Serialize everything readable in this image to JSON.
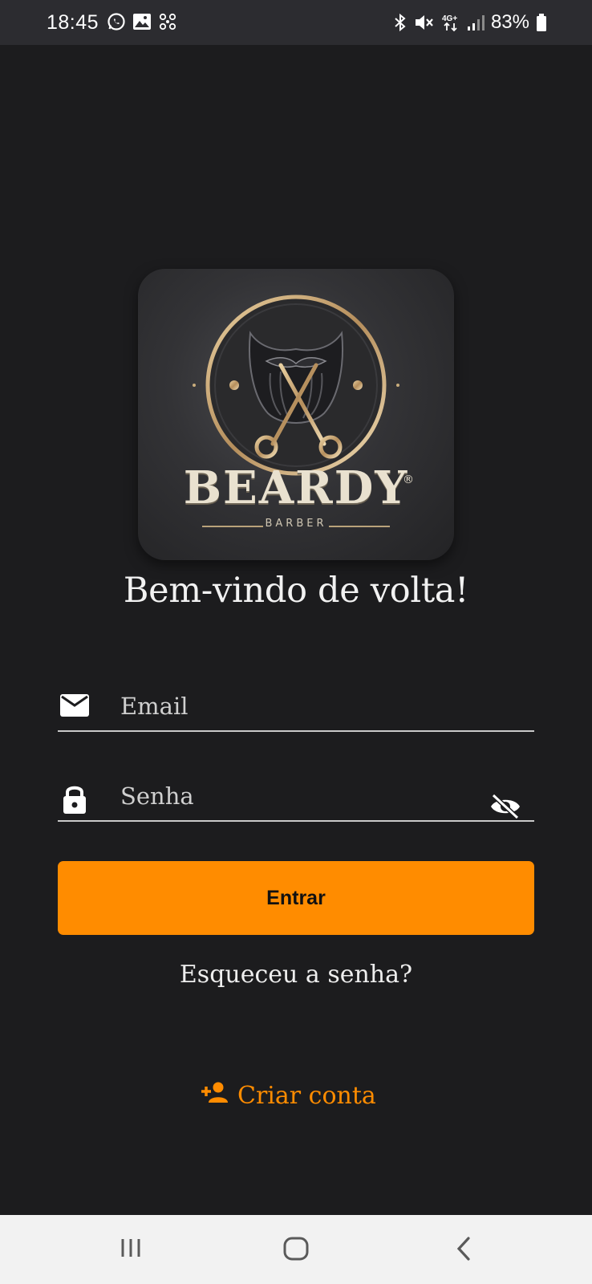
{
  "status_bar": {
    "time": "18:45",
    "battery": "83%",
    "left_icons": [
      "whatsapp-icon",
      "gallery-icon",
      "pinwheel-icon"
    ],
    "right_icons": [
      "bluetooth-icon",
      "mute-icon",
      "4g-icon",
      "signal-icon",
      "battery-icon"
    ],
    "network_label": "4G+"
  },
  "logo": {
    "brand": "BEARDY",
    "registered_mark": "®",
    "subtitle": "BARBER"
  },
  "welcome_text": "Bem-vindo de volta!",
  "form": {
    "email_placeholder": "Email",
    "password_placeholder": "Senha",
    "submit_label": "Entrar",
    "forgot_label": "Esqueceu a senha?",
    "create_label": "Criar conta"
  },
  "colors": {
    "background": "#1c1c1e",
    "accent": "#ff8c00",
    "status_bar": "#2c2c30",
    "nav_bar": "#f2f2f2"
  },
  "nav_bar": {
    "buttons": [
      "recent-apps-icon",
      "home-icon",
      "back-icon"
    ]
  }
}
